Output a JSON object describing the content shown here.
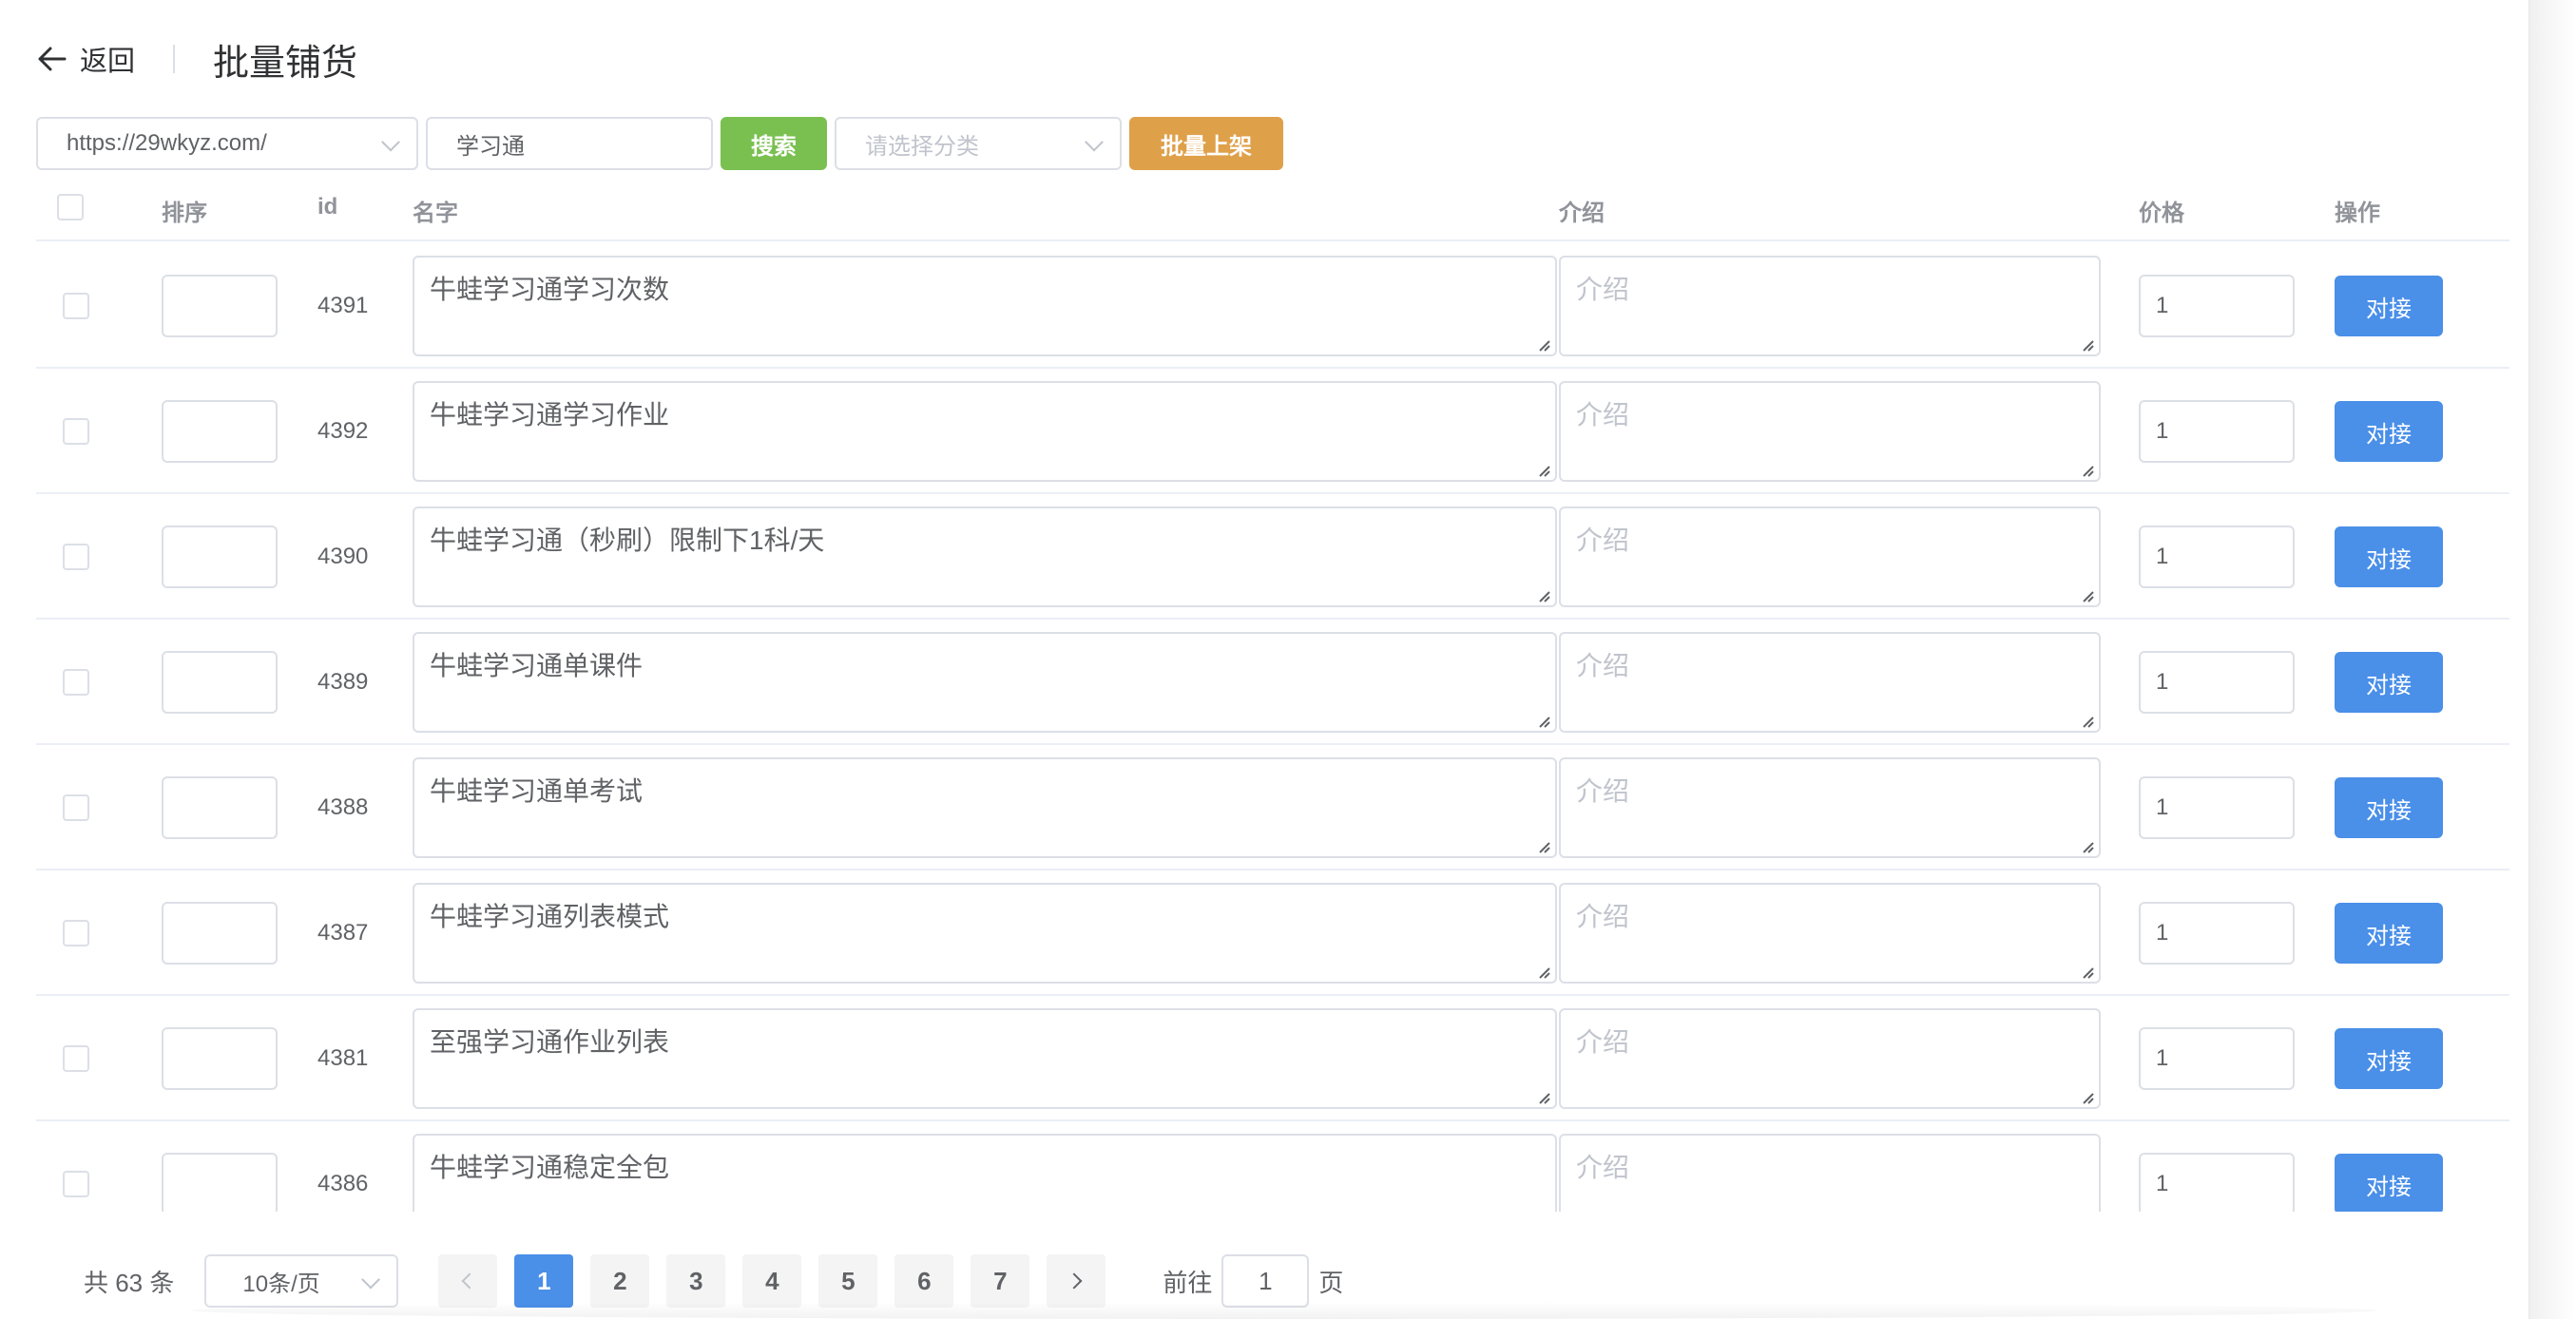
{
  "header": {
    "back_label": "返回",
    "title": "批量铺货"
  },
  "toolbar": {
    "site_value": "https://29wkyz.com/",
    "keyword_value": "学习通",
    "search_label": "搜索",
    "category_placeholder": "请选择分类",
    "batch_label": "批量上架"
  },
  "table": {
    "headers": {
      "sort": "排序",
      "id": "id",
      "name": "名字",
      "desc": "介绍",
      "price": "价格",
      "action": "操作"
    },
    "desc_placeholder": "介绍",
    "action_label": "对接",
    "rows": [
      {
        "id": "4391",
        "name": "牛蛙学习通学习次数",
        "price": "1"
      },
      {
        "id": "4392",
        "name": "牛蛙学习通学习作业",
        "price": "1"
      },
      {
        "id": "4390",
        "name": "牛蛙学习通（秒刷）限制下1科/天",
        "price": "1"
      },
      {
        "id": "4389",
        "name": "牛蛙学习通单课件",
        "price": "1"
      },
      {
        "id": "4388",
        "name": "牛蛙学习通单考试",
        "price": "1"
      },
      {
        "id": "4387",
        "name": "牛蛙学习通列表模式",
        "price": "1"
      },
      {
        "id": "4381",
        "name": "至强学习通作业列表",
        "price": "1"
      },
      {
        "id": "4386",
        "name": "牛蛙学习通稳定全包",
        "price": "1"
      }
    ]
  },
  "pagination": {
    "total": "共 63 条",
    "page_size": "10条/页",
    "pages": [
      "1",
      "2",
      "3",
      "4",
      "5",
      "6",
      "7"
    ],
    "current": "1",
    "goto_prefix": "前往",
    "goto_value": "1",
    "goto_suffix": "页"
  },
  "colors": {
    "primary": "#4a8fe8",
    "success": "#7ac051",
    "warning": "#dfa04a"
  }
}
